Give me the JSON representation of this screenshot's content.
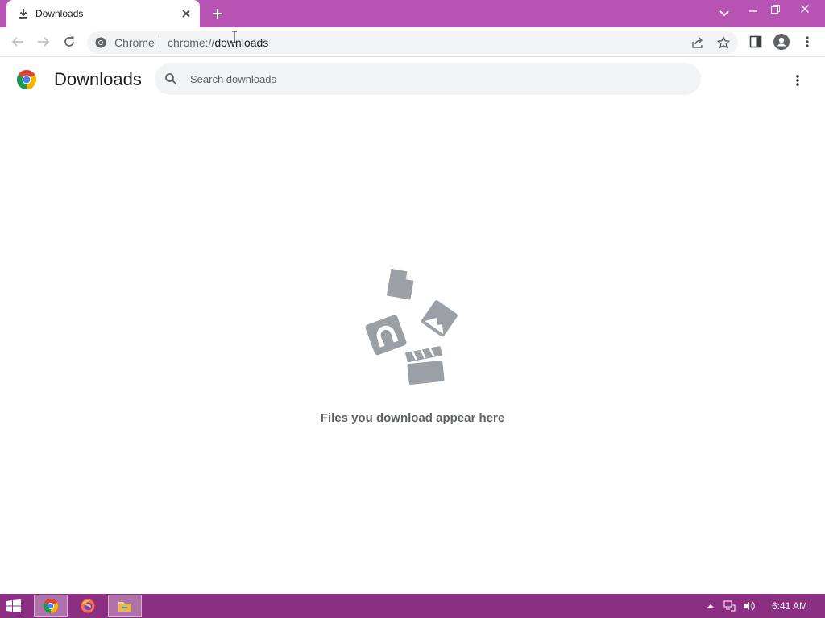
{
  "tab": {
    "title": "Downloads"
  },
  "toolbar": {
    "site_chip": "Chrome",
    "url_scheme": "chrome://",
    "url_path": "downloads"
  },
  "page": {
    "title": "Downloads"
  },
  "search": {
    "placeholder": "Search downloads",
    "value": ""
  },
  "empty_state": {
    "message": "Files you download appear here"
  },
  "taskbar": {
    "time": "6:41 AM",
    "apps": [
      "Google Chrome",
      "Firefox",
      "File Explorer"
    ]
  },
  "colors": {
    "titlebar": "#b753b3",
    "taskbar": "#8b2f82",
    "illustration": "#9aa0a6"
  },
  "icons": [
    "download-icon",
    "close-icon",
    "plus-icon",
    "chevron-down-icon",
    "minimize-icon",
    "restore-icon",
    "back-arrow-icon",
    "forward-arrow-icon",
    "reload-icon",
    "chrome-icon",
    "share-icon",
    "star-icon",
    "side-panel-icon",
    "profile-icon",
    "kebab-menu-icon",
    "search-icon"
  ]
}
